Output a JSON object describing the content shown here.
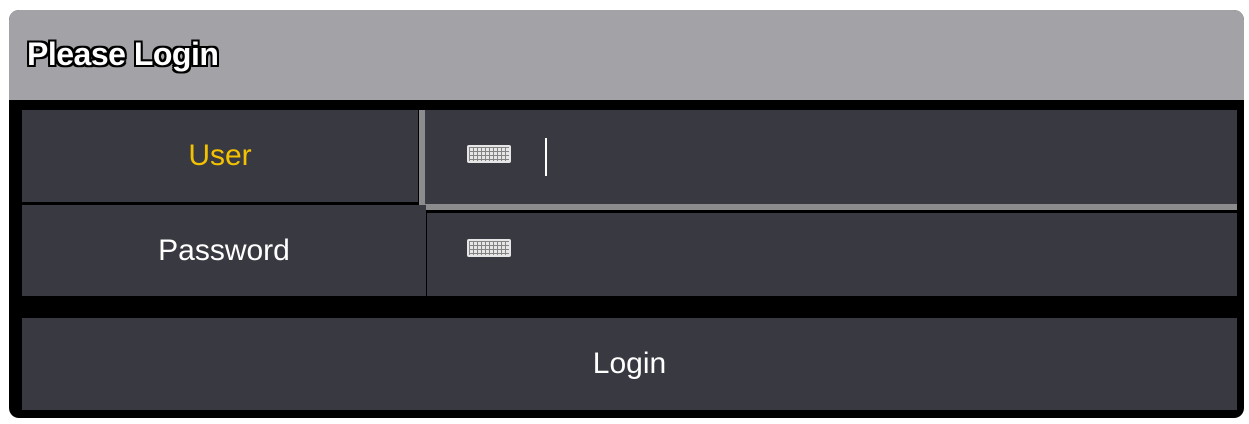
{
  "dialog": {
    "title": "Please Login"
  },
  "form": {
    "user_label": "User",
    "password_label": "Password",
    "user_value": "",
    "password_value": "",
    "keyboard_icon": "keyboard-icon"
  },
  "actions": {
    "login_label": "Login"
  },
  "colors": {
    "titlebar": "#a3a3a7",
    "cell": "#393941",
    "active_label": "#f2c200",
    "focus_border": "#8c8c8e"
  }
}
